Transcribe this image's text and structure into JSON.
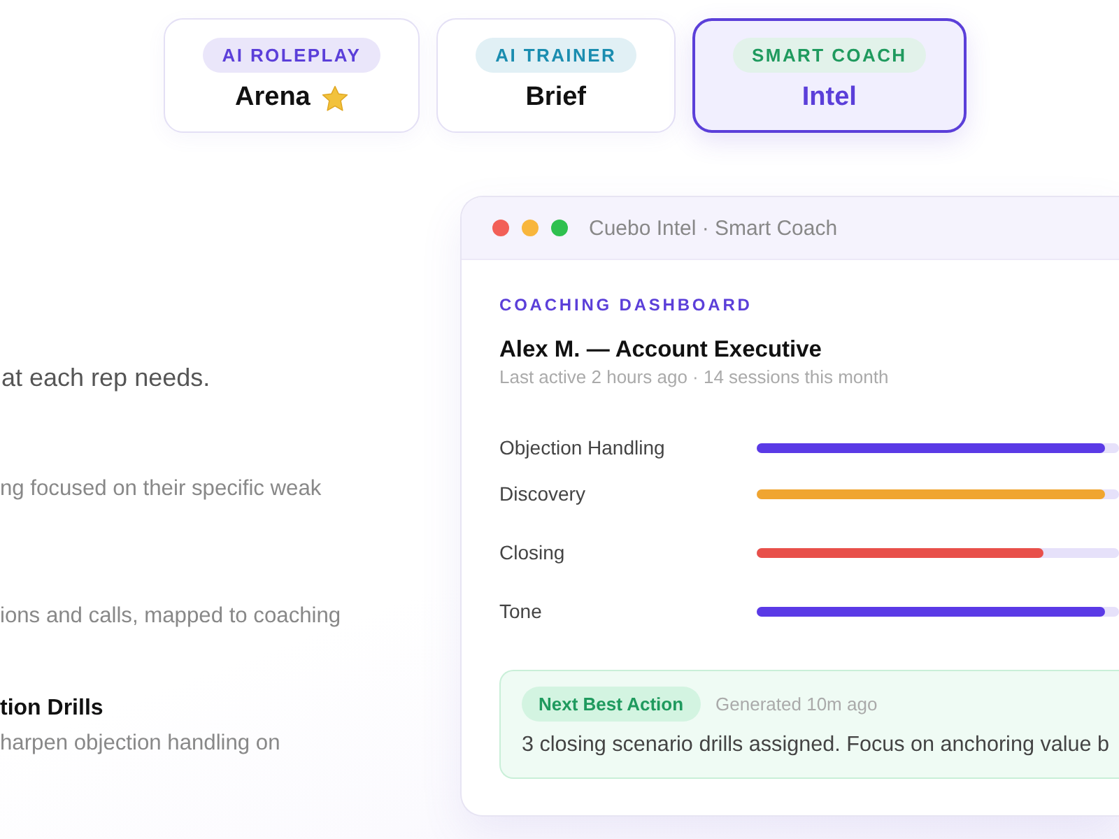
{
  "tabs": [
    {
      "badge": "AI ROLEPLAY",
      "color": "#5b3fd9",
      "title": "Arena",
      "kind": "starred",
      "selected": false
    },
    {
      "badge": "AI TRAINER",
      "color": "#1b8db0",
      "title": "Brief",
      "kind": "plain",
      "selected": false
    },
    {
      "badge": "SMART COACH",
      "color": "#1f9a5e",
      "title": "Intel",
      "kind": "plain",
      "selected": true
    }
  ],
  "intro": "at each rep needs.",
  "features": [
    {
      "description": "ng focused on their specific weak"
    },
    {
      "description": "ions and calls, mapped to coaching"
    },
    {
      "title": "tion Drills",
      "description": "harpen objection handling on"
    }
  ],
  "app_window": {
    "title": "Cuebo Intel · Smart Coach",
    "section_label": "COACHING DASHBOARD",
    "rep_name": "Alex M. — Account Executive",
    "rep_meta": "Last active 2 hours ago · 14 sessions this month",
    "skills": [
      {
        "name": "Objection Handling",
        "level": 0.96,
        "color": "#5a3ae6"
      },
      {
        "name": "Discovery",
        "level": 0.96,
        "color": "#f0a530"
      },
      {
        "name": "Closing",
        "level": 0.79,
        "color": "#e8504a"
      },
      {
        "name": "Tone",
        "level": 0.96,
        "color": "#5a3ae6"
      }
    ],
    "next_action": {
      "badge": "Next Best Action",
      "meta": "Generated 10m ago",
      "text": "3 closing scenario drills assigned. Focus on anchoring value b"
    }
  }
}
